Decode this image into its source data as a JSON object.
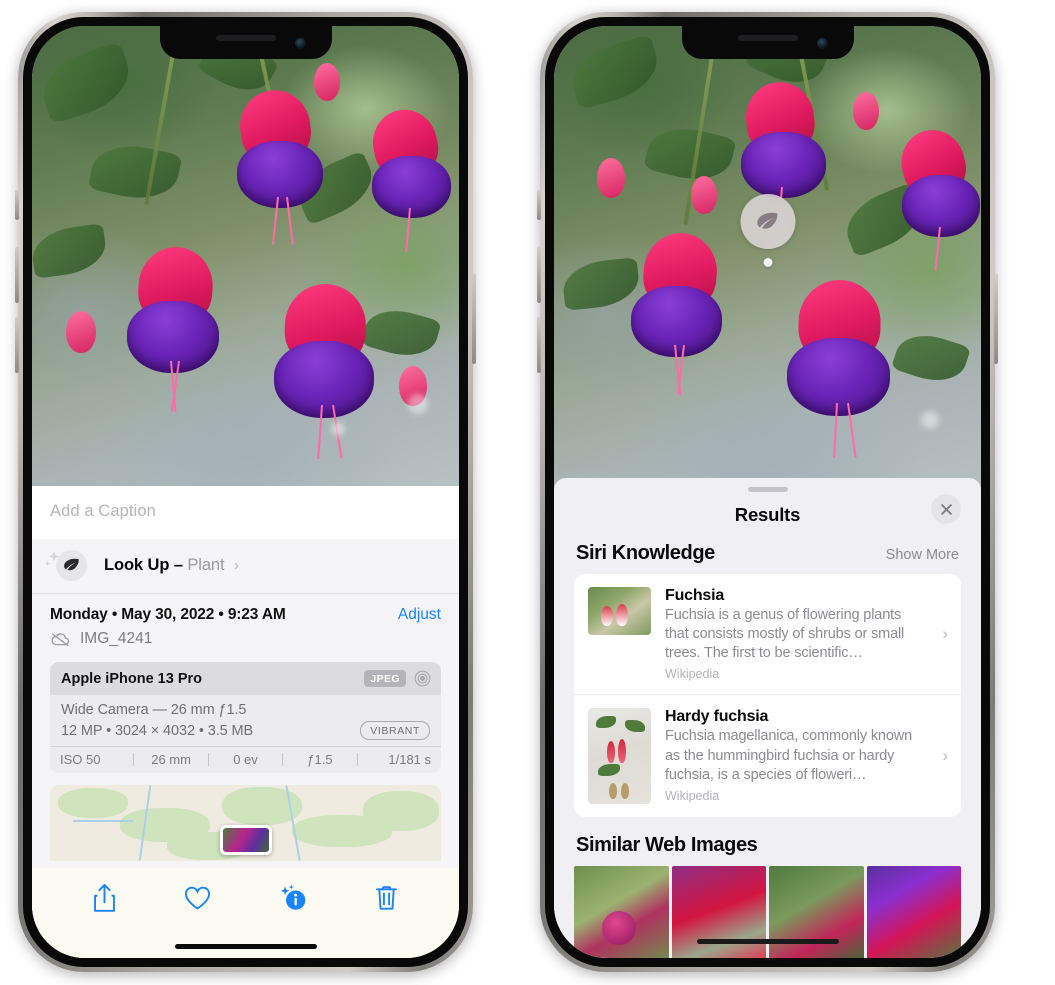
{
  "left_phone": {
    "name": "photos-info-screen",
    "caption_placeholder": "Add a Caption",
    "lookup": {
      "label": "Look Up",
      "dash": "–",
      "subject": "Plant",
      "chevron": "›",
      "icon": "leaf-icon"
    },
    "metadata": {
      "date_line": "Monday • May 30, 2022 • 9:23 AM",
      "adjust_label": "Adjust",
      "filename": "IMG_4241",
      "cloud_icon": "cloud-slash-icon"
    },
    "exif": {
      "model": "Apple iPhone 13 Pro",
      "format_badge": "JPEG",
      "lens_icon": "aperture-icon",
      "lens_line": "Wide Camera — 26 mm ƒ1.5",
      "dims_line": "12 MP • 3024 × 4032 • 3.5 MB",
      "style_badge": "VIBRANT",
      "settings": [
        "ISO 50",
        "26 mm",
        "0 ev",
        "ƒ1.5",
        "1/181 s"
      ]
    },
    "toolbar": [
      {
        "name": "share-button",
        "icon": "share-icon"
      },
      {
        "name": "favorite-button",
        "icon": "heart-icon"
      },
      {
        "name": "info-button",
        "icon": "info-sparkle-icon"
      },
      {
        "name": "delete-button",
        "icon": "trash-icon"
      }
    ]
  },
  "right_phone": {
    "name": "visual-lookup-results-screen",
    "badge": {
      "icon": "leaf-icon",
      "name": "visual-lookup-badge"
    },
    "sheet": {
      "title": "Results",
      "close_icon": "close-icon"
    },
    "siri_knowledge": {
      "heading": "Siri Knowledge",
      "show_more": "Show More",
      "cards": [
        {
          "title": "Fuchsia",
          "description": "Fuchsia is a genus of flowering plants that consists mostly of shrubs or small trees. The first to be scientific…",
          "source": "Wikipedia",
          "chevron": "›"
        },
        {
          "title": "Hardy fuchsia",
          "description": "Fuchsia magellanica, commonly known as the hummingbird fuchsia or hardy fuchsia, is a species of floweri…",
          "source": "Wikipedia",
          "chevron": "›"
        }
      ]
    },
    "similar_web_images": {
      "heading": "Similar Web Images",
      "count": 4
    }
  },
  "colors": {
    "accent_blue": "#1a84ff",
    "sheet_bg": "#f0f0f4",
    "card_bg": "#ffffff",
    "secondary_text": "#8b8b92"
  }
}
